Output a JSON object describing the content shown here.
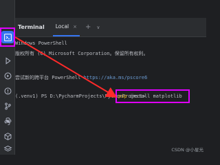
{
  "toolwindow": {
    "title": "Terminal",
    "tabs": [
      {
        "label": "Local",
        "close": "×"
      }
    ],
    "add_tab": "+",
    "menu": "∨"
  },
  "sidebar": {
    "icons": [
      "terminal-icon",
      "run-icon",
      "services-icon",
      "problems-icon",
      "git-icon",
      "python-console-icon",
      "packages-icon",
      "layers-icon"
    ]
  },
  "terminal": {
    "lines": [
      "Windows PowerShell",
      "版权所有 (C) Microsoft Corporation。保留所有权利。",
      "",
      "尝试新的跨平台 PowerShell"
    ],
    "link_text": "https://aka.ms/pscore6",
    "prompt": "(.venv1) PS D:\\PycharmProjects\\PythonProject>",
    "command_keyword": "pip",
    "command_rest": " install matplotlib"
  },
  "annotation": {
    "highlight_color": "#e000ff",
    "arrow_color": "#ff2a2a"
  },
  "watermark": "CSDN @小星光"
}
